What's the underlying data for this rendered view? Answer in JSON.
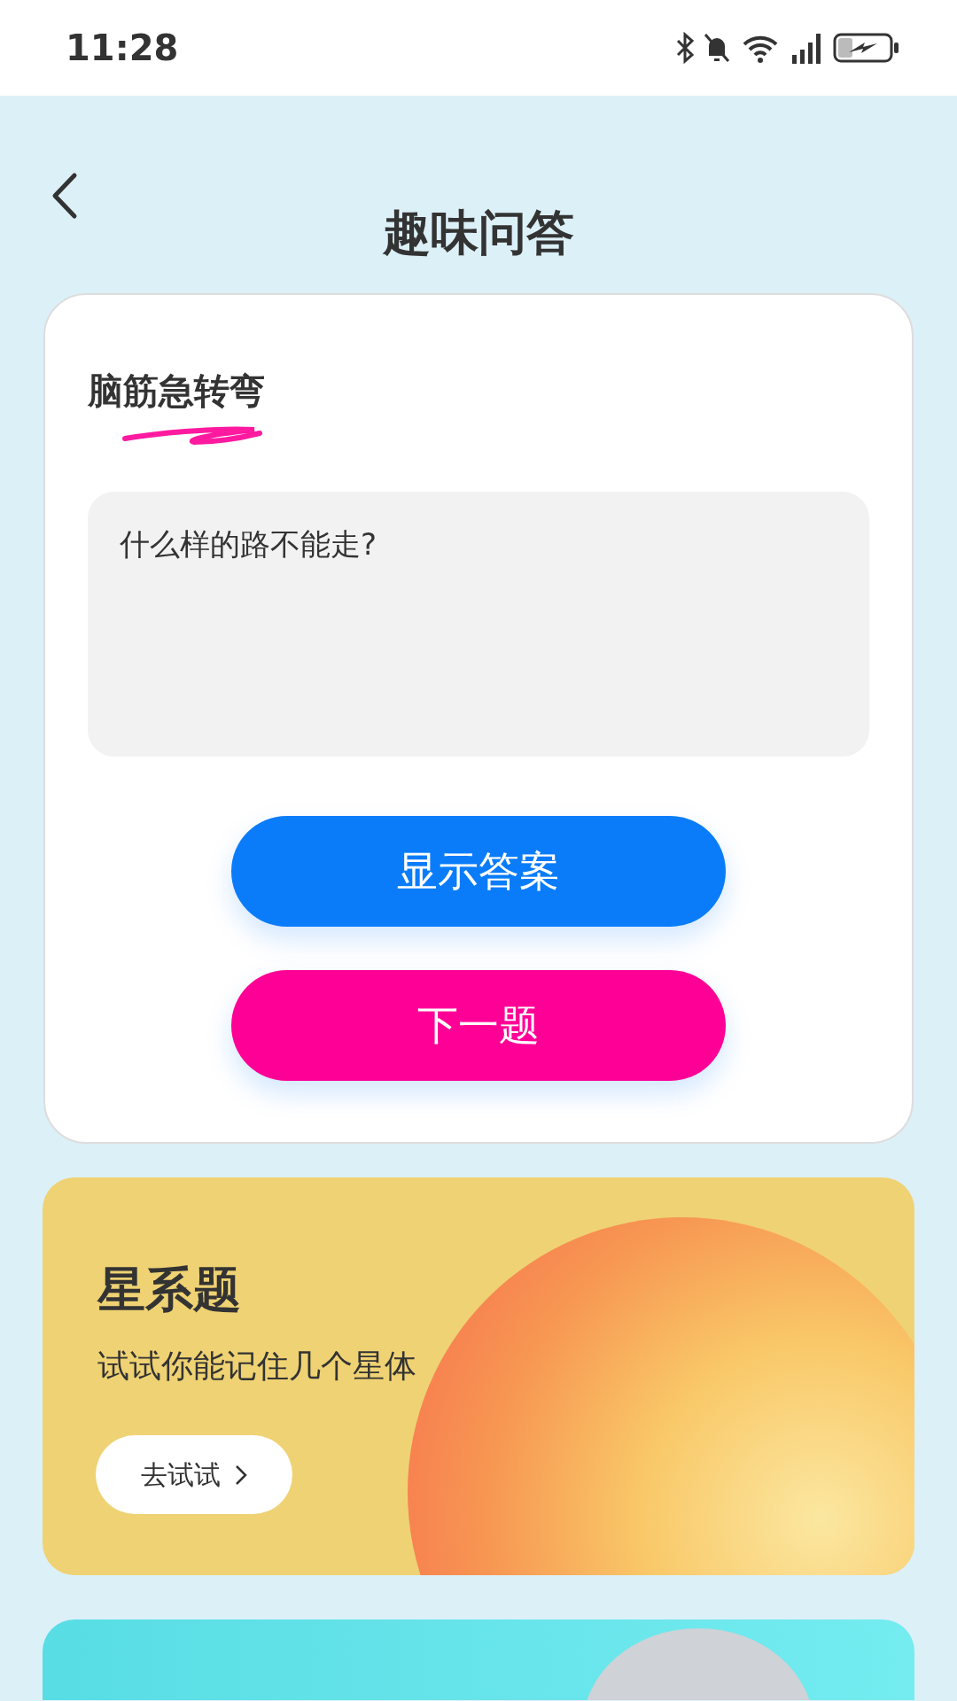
{
  "status_bar": {
    "time": "11:28"
  },
  "header": {
    "title": "趣味问答"
  },
  "quiz_card": {
    "section_title": "脑筋急转弯",
    "question": "什么样的路不能走?",
    "buttons": [
      {
        "label": "显示答案",
        "kind": "primary"
      },
      {
        "label": "下一题",
        "kind": "secondary"
      }
    ]
  },
  "promo_cards": [
    {
      "kind": "planet",
      "title": "星系题",
      "subtitle": "试试你能记住几个星体",
      "action": "去试试"
    },
    {
      "kind": "figure"
    }
  ]
}
